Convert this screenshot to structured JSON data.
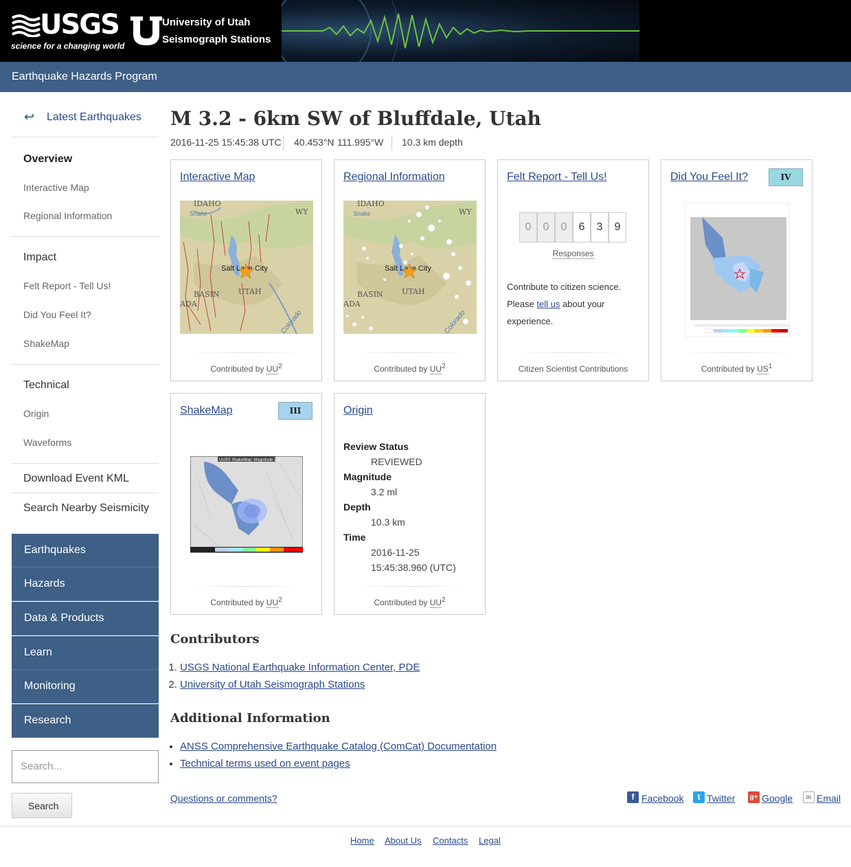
{
  "header": {
    "usgs_wordmark": "USGS",
    "usgs_tagline": "science for a changing world",
    "uu_line1": "University of Utah",
    "uu_line2": "Seismograph Stations",
    "program": "Earthquake Hazards Program"
  },
  "sidebar": {
    "back_label": "Latest Earthquakes",
    "items": [
      {
        "label": "Overview"
      },
      {
        "label": "Interactive Map"
      },
      {
        "label": "Regional Information"
      },
      {
        "label": "Impact"
      },
      {
        "label": "Felt Report - Tell Us!"
      },
      {
        "label": "Did You Feel It?"
      },
      {
        "label": "ShakeMap"
      },
      {
        "label": "Technical"
      },
      {
        "label": "Origin"
      },
      {
        "label": "Waveforms"
      },
      {
        "label": "Download Event KML"
      },
      {
        "label": "Search Nearby Seismicity"
      }
    ],
    "nav": [
      "Earthquakes",
      "Hazards",
      "Data & Products",
      "Learn",
      "Monitoring",
      "Research"
    ],
    "search_placeholder": "Search...",
    "search_button": "Search"
  },
  "event": {
    "title": "M 3.2 - 6km SW of Bluffdale, Utah",
    "time": "2016-11-25 15:45:38 UTC",
    "lat": "40.453°N",
    "lon": "111.995°W",
    "depth": "10.3 km depth"
  },
  "cards": {
    "interactive_map": {
      "title": "Interactive Map",
      "contributed": "Contributed by",
      "code": "UU",
      "sup": "2"
    },
    "regional": {
      "title": "Regional Information",
      "contributed": "Contributed by",
      "code": "UU",
      "sup": "2"
    },
    "felt": {
      "title": "Felt Report - Tell Us!",
      "digits": [
        "0",
        "0",
        "0",
        "6",
        "3",
        "9"
      ],
      "responses": "Responses",
      "text_before": "Contribute to citizen science. Please ",
      "link": "tell us",
      "text_after": " about your experience.",
      "footer": "Citizen Scientist Contributions"
    },
    "dyfi": {
      "title": "Did You Feel It?",
      "badge": "IV",
      "contributed": "Contributed by",
      "code": "US",
      "sup": "1"
    },
    "shakemap": {
      "title": "ShakeMap",
      "badge": "III",
      "contributed": "Contributed by",
      "code": "UU",
      "sup": "2",
      "map_title": "UUSS ShakeMap: Magnitude 3.2"
    },
    "origin": {
      "title": "Origin",
      "rows": [
        {
          "k": "Review Status",
          "v": "REVIEWED"
        },
        {
          "k": "Magnitude",
          "v": "3.2 ml"
        },
        {
          "k": "Depth",
          "v": "10.3 km"
        },
        {
          "k": "Time",
          "v": "2016-11-25",
          "v2": "15:45:38.960 (UTC)"
        }
      ],
      "contributed": "Contributed by",
      "code": "UU",
      "sup": "2"
    }
  },
  "map_labels": {
    "idaho": "IDAHO",
    "wy": "WY",
    "slc": "Salt Lake City",
    "utah": "UTAH",
    "basin": "BASIN",
    "ada": "ADA",
    "colorado": "Colorado",
    "snake": "Snake"
  },
  "contributors": {
    "title": "Contributors",
    "items": [
      "USGS National Earthquake Information Center, PDE",
      "University of Utah Seismograph Stations"
    ]
  },
  "additional": {
    "title": "Additional Information",
    "items": [
      "ANSS Comprehensive Earthquake Catalog (ComCat) Documentation",
      "Technical terms used on event pages"
    ]
  },
  "footer": {
    "questions": "Questions or comments?",
    "share": [
      "Facebook",
      "Twitter",
      "Google",
      "Email"
    ],
    "links": [
      "Home",
      "About Us",
      "Contacts",
      "Legal"
    ]
  },
  "colors": {
    "nav_blue": "#3e5f86",
    "link_blue": "#2a4a8a",
    "badge_iv": "#99d7e1",
    "badge_iii": "#a6d4ec"
  }
}
